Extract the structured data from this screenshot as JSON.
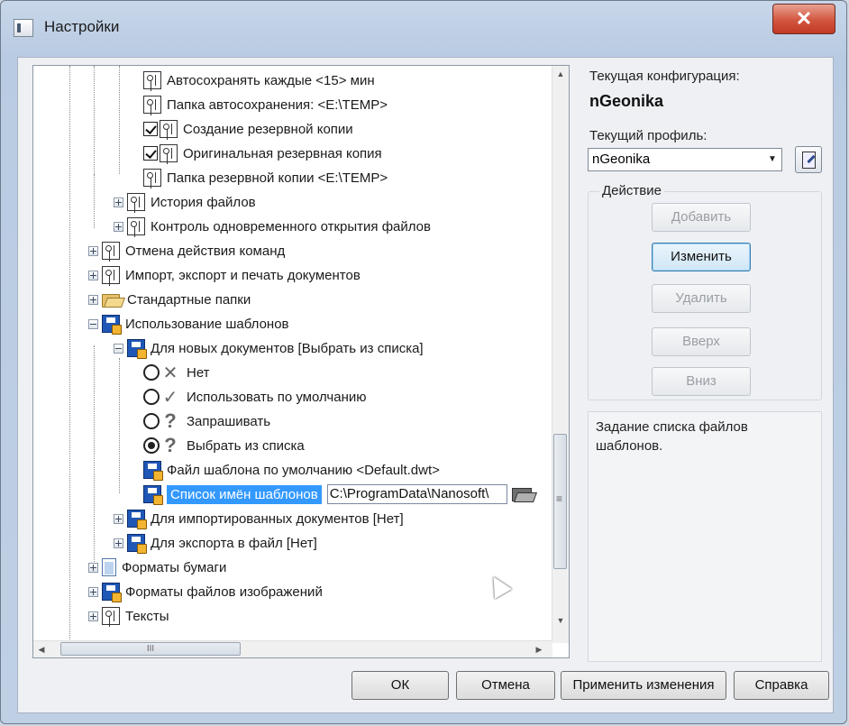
{
  "window": {
    "title": "Настройки",
    "close_glyph": "✕"
  },
  "tree": {
    "items": [
      "Автосохранять каждые <15> мин",
      "Папка автосохранения: <E:\\TEMP>",
      "Создание резервной копии",
      "Оригинальная  резервная копия",
      "Папка резервной копии <E:\\TEMP>",
      "История файлов",
      "Контроль одновременного открытия файлов",
      "Отмена действия команд",
      "Импорт, экспорт и печать документов",
      "Стандартные папки",
      "Использование шаблонов",
      "Для новых документов [Выбрать из списка]",
      "Нет",
      "Использовать по умолчанию",
      "Запрашивать",
      "Выбрать из списка",
      "Файл шаблона по умолчанию <Default.dwt>",
      "Список имён шаблонов",
      "Для импортированных документов [Нет]",
      "Для экспорта в файл [Нет]",
      "Форматы бумаги",
      "Форматы файлов изображений",
      "Тексты"
    ],
    "edit_value": "C:\\ProgramData\\Nanosoft\\",
    "glyphs": {
      "none": "✕",
      "default": "✓",
      "ask": "?",
      "choose": "?"
    }
  },
  "scrollbars": {
    "up": "▲",
    "down": "▼",
    "left": "◀",
    "right": "▶",
    "grip": "III"
  },
  "side": {
    "config_label": "Текущая конфигурация:",
    "config_value": "nGeonika",
    "profile_label": "Текущий профиль:",
    "profile_value": "nGeonika",
    "combo_arrow": "▼",
    "action_label": "Действие",
    "actions": [
      {
        "label": "Добавить",
        "enabled": false
      },
      {
        "label": "Изменить",
        "enabled": true
      },
      {
        "label": "Удалить",
        "enabled": false
      },
      {
        "label": "Вверх",
        "enabled": false
      },
      {
        "label": "Вниз",
        "enabled": false
      }
    ],
    "description": "Задание списка файлов шаблонов."
  },
  "footer": {
    "ok": "ОК",
    "cancel": "Отмена",
    "apply": "Применить изменения",
    "help": "Справка"
  }
}
